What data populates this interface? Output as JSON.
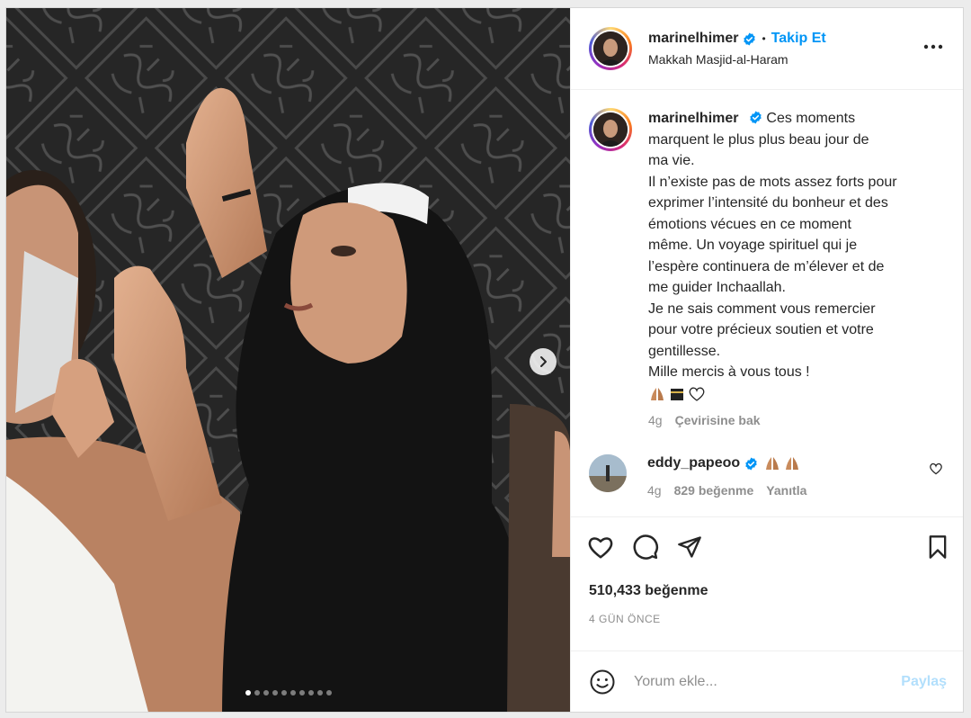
{
  "header": {
    "username": "marinelhimer",
    "verified_icon": "verified-badge-icon",
    "separator": "•",
    "follow_label": "Takip Et",
    "location": "Makkah Masjid-al-Haram",
    "more_icon": "more-options-icon"
  },
  "caption": {
    "username": "marinelhimer",
    "lines": [
      "Ces moments",
      "marquent le plus plus beau jour de",
      "ma vie.",
      "Il n’existe pas de mots assez forts pour",
      "exprimer l’intensité du bonheur et des",
      "émotions vécues en ce moment",
      "même. Un voyage spirituel qui je",
      "l’espère continuera de m’élever et de",
      "me guider Inchaallah.",
      "Je ne sais comment vous remercier",
      "pour votre précieux soutien et votre",
      "gentillesse.",
      "Mille mercis à vous tous !"
    ],
    "emojis": [
      "praying-hands-emoji",
      "kaaba-emoji",
      "white-heart-emoji"
    ],
    "age": "4g",
    "translate_label": "Çevirisine bak"
  },
  "reply": {
    "username": "eddy_papeoo",
    "emojis": [
      "praying-hands-emoji",
      "praying-hands-emoji"
    ],
    "age": "4g",
    "likes": "829 beğenme",
    "reply_label": "Yanıtla"
  },
  "actions": {
    "like_icon": "heart-icon",
    "comment_icon": "comment-icon",
    "share_icon": "paper-plane-icon",
    "save_icon": "bookmark-icon"
  },
  "likes_text": "510,433 beğenme",
  "time_text": "4 GÜN ÖNCE",
  "comment_box": {
    "placeholder": "Yorum ekle...",
    "post_label": "Paylaş",
    "emoji_icon": "smiley-icon"
  },
  "carousel": {
    "slide_count": 10,
    "active_index": 0,
    "next_icon": "chevron-right-icon"
  },
  "colors": {
    "accent": "#0095f6",
    "post_disabled": "#b2dffc",
    "muted": "#8e8e8e",
    "text": "#262626"
  }
}
